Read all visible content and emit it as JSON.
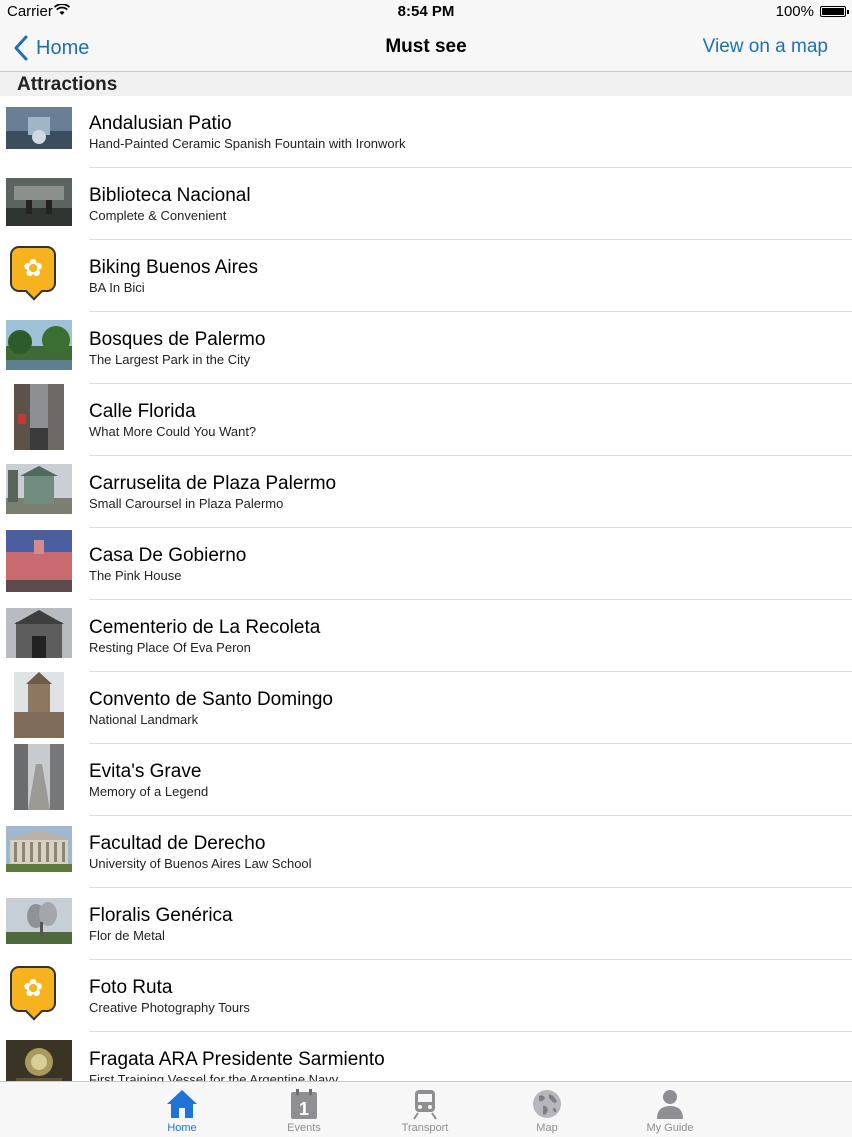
{
  "status_bar": {
    "carrier": "Carrier",
    "time": "8:54 PM",
    "battery": "100%"
  },
  "nav": {
    "back_label": "Home",
    "title": "Must see",
    "right_label": "View on a map"
  },
  "section": {
    "title": "Attractions"
  },
  "items": [
    {
      "title": "Andalusian Patio",
      "subtitle": "Hand-Painted Ceramic Spanish Fountain with Ironwork",
      "icon": "photo"
    },
    {
      "title": "Biblioteca Nacional",
      "subtitle": "Complete & Convenient",
      "icon": "photo"
    },
    {
      "title": "Biking Buenos Aires",
      "subtitle": "BA In Bici",
      "icon": "app-logo"
    },
    {
      "title": "Bosques de Palermo",
      "subtitle": "The Largest Park in the City",
      "icon": "photo"
    },
    {
      "title": "Calle Florida",
      "subtitle": "What More Could You Want?",
      "icon": "photo"
    },
    {
      "title": "Carruselita de Plaza Palermo",
      "subtitle": "Small Caroursel in Plaza Palermo",
      "icon": "photo"
    },
    {
      "title": "Casa De Gobierno",
      "subtitle": "The Pink House",
      "icon": "photo"
    },
    {
      "title": "Cementerio de La Recoleta",
      "subtitle": "Resting Place Of Eva Peron",
      "icon": "photo"
    },
    {
      "title": "Convento de Santo Domingo",
      "subtitle": "National Landmark",
      "icon": "photo"
    },
    {
      "title": "Evita's Grave",
      "subtitle": "Memory of a Legend",
      "icon": "photo"
    },
    {
      "title": "Facultad de Derecho",
      "subtitle": "University of Buenos Aires Law School",
      "icon": "photo"
    },
    {
      "title": "Floralis Genérica",
      "subtitle": "Flor de Metal",
      "icon": "photo"
    },
    {
      "title": "Foto Ruta",
      "subtitle": "Creative Photography Tours",
      "icon": "app-logo"
    },
    {
      "title": "Fragata ARA Presidente Sarmiento",
      "subtitle": "First Training Vessel for the Argentine Navy",
      "icon": "photo"
    }
  ],
  "tabs": [
    {
      "label": "Home",
      "icon": "home-icon",
      "active": true
    },
    {
      "label": "Events",
      "icon": "calendar-icon",
      "active": false
    },
    {
      "label": "Transport",
      "icon": "train-icon",
      "active": false
    },
    {
      "label": "Map",
      "icon": "globe-icon",
      "active": false
    },
    {
      "label": "My Guide",
      "icon": "person-icon",
      "active": false
    }
  ],
  "colors": {
    "accent": "#1f6fb4",
    "tab_active": "#1f74d6",
    "tab_inactive": "#8e8e93",
    "logo": "#f7b31e"
  }
}
